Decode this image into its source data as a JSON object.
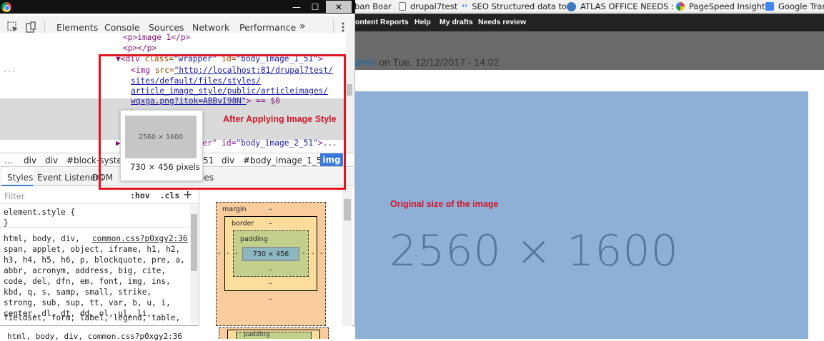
{
  "bookmarks": [
    {
      "label": "ban Boar",
      "icon": "page-icon"
    },
    {
      "label": "drupal7test",
      "icon": "document-icon"
    },
    {
      "label": "SEO Structured data to",
      "icon": "code-icon"
    },
    {
      "label": "ATLAS OFFICE NEEDS :",
      "icon": "globe-icon"
    },
    {
      "label": "PageSpeed Insights",
      "icon": "pagespeed-icon"
    },
    {
      "label": "Google Tran",
      "icon": "translate-icon"
    }
  ],
  "admin_bar": [
    "ontent",
    "Reports",
    "Help",
    "My drafts",
    "Needs review"
  ],
  "node_meta": {
    "author": "dmin",
    "text": " on Tue, 12/12/2017 - 14:02"
  },
  "page": {
    "original_label": "Original size of the image",
    "image_text": "2560 × 1600",
    "colors": {
      "placeholder": "#8fb0d6",
      "annotation": "#d2162b"
    }
  },
  "devtools": {
    "window_buttons": [
      "—",
      "☐",
      "✕"
    ],
    "tabs": [
      "Elements",
      "Console",
      "Sources",
      "Network",
      "Performance",
      "»"
    ],
    "active_tab": "Elements",
    "tree": {
      "line1_tag": "<p>image 1</p>",
      "line2_tag": "<p></p>",
      "wrapper_open": "▼<div ",
      "wrapper_attr1": "class=",
      "wrapper_val1": "\"wrapper\"",
      "wrapper_attr2": " id=",
      "wrapper_val2": "\"body_image_1_51\"",
      "wrapper_close": ">",
      "ellipsis": "...",
      "img_tag": "<img ",
      "img_attr": "src=",
      "img_src1": "\"http://localhost:81/drupal7test/",
      "img_src2": "sites/default/files/styles/",
      "img_src3": "article_image_style/public/articleimages/",
      "img_src4": "wqxga.png?itok=ABBvI98N\"",
      "img_end": "> == $0",
      "partial_close": "</",
      "wrapper2_prefix": "▶<div class=\"wrapper\" id=",
      "wrapper2_val": "\"body_image_2_51\"",
      "wrapper2_end": ">..."
    },
    "tooltip": {
      "thumb_text": "2560 × 1600",
      "size": "730 × 456 pixels"
    },
    "breadcrumbs": [
      "...",
      "div",
      "div",
      "#block-system",
      "51",
      "div",
      "#body_image_1_51",
      "img"
    ],
    "subtabs": [
      "Styles",
      "Event Listeners",
      "DOM",
      "ies"
    ],
    "filter": {
      "placeholder": "Filter",
      "hov": ":hov",
      "cls": ".cls",
      "add": "+"
    },
    "styles": {
      "element_style": "element.style {",
      "close": "}",
      "rule_selector": "html, body, div,",
      "rule_source": "common.css?p0xgy2:36",
      "selector_lines": [
        "span, applet, object, iframe, h1, h2,",
        "h3, h4, h5, h6, p, blockquote, pre, a,",
        "abbr, acronym, address, big, cite,",
        "code, del, dfn, em, font, img, ins,",
        "kbd, q, s, samp, small, strike,",
        "strong, sub, sup, tt, var, b, u, i,",
        "center, dl, dt, dd, ol, ul, li,",
        "fieldset, form, label, legend, table,"
      ],
      "next_rule": "html, body, div,    common.css?p0xgy2:36"
    },
    "box_model": {
      "margin": "margin",
      "border": "border",
      "padding": "padding",
      "content": "730 × 456",
      "dash": "–",
      "dash_short": "-",
      "padding_below": "padding"
    },
    "annotation": "After Applying Image Style"
  }
}
